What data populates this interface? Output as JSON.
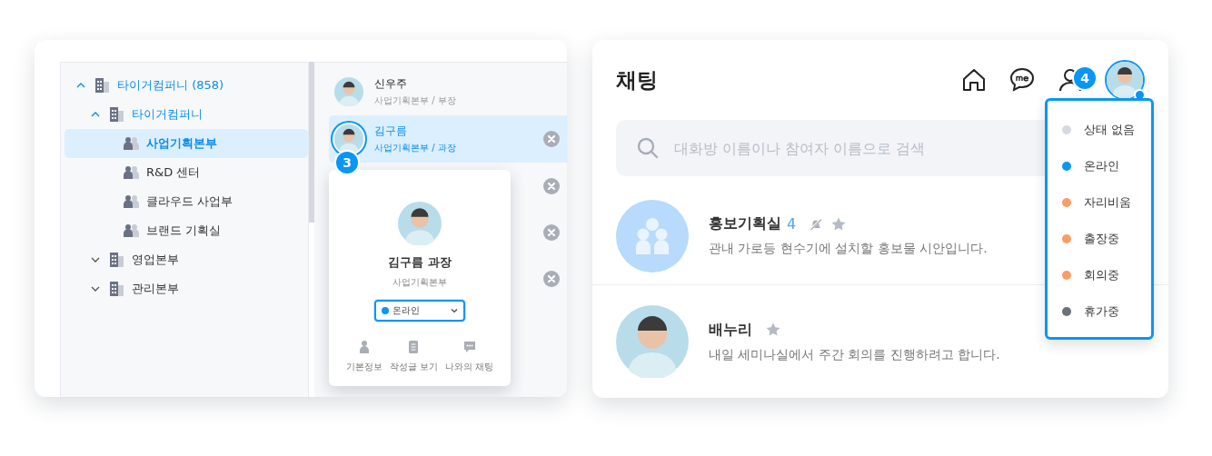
{
  "org_panel": {
    "tree": [
      {
        "label": "타이거컴퍼니 (858)",
        "kind": "company",
        "expanded": true,
        "selected": false,
        "children": [
          {
            "label": "타이거컴퍼니",
            "kind": "company",
            "expanded": true,
            "selected": false,
            "children": [
              {
                "label": "사업기획본부",
                "kind": "department",
                "selected": true
              },
              {
                "label": "R&D 센터",
                "kind": "department",
                "selected": false
              },
              {
                "label": "클라우드 사업부",
                "kind": "department",
                "selected": false
              },
              {
                "label": "브랜드 기획실",
                "kind": "department",
                "selected": false
              }
            ]
          },
          {
            "label": "영업본부",
            "kind": "company",
            "expanded": false,
            "selected": false
          },
          {
            "label": "관리본부",
            "kind": "company",
            "expanded": false,
            "selected": false
          }
        ]
      }
    ],
    "members": [
      {
        "name": "신우주",
        "subtitle": "사업기획본부 / 부장",
        "selected": false,
        "removable": false
      },
      {
        "name": "김구름",
        "subtitle": "사업기획본부 / 과장",
        "selected": true,
        "removable": true,
        "callout": "3"
      }
    ],
    "covered_rows": [
      {
        "removable": true
      },
      {
        "removable": true
      },
      {
        "removable": true
      }
    ],
    "profile_popup": {
      "name": "김구름 과장",
      "department": "사업기획본부",
      "status": {
        "label": "온라인",
        "color": "#0a96f5"
      },
      "actions": [
        {
          "label": "기본정보",
          "kind": "person"
        },
        {
          "label": "작성글 보기",
          "kind": "document"
        },
        {
          "label": "나와의 채팅",
          "kind": "chat"
        }
      ]
    }
  },
  "chat_panel": {
    "title": "채팅",
    "callout": "4",
    "status_dot": {
      "color": "#0a96f5"
    },
    "search": {
      "placeholder": "대화방 이름이나 참여자 이름으로 검색"
    },
    "status_menu": [
      {
        "label": "상태 없음",
        "color": "#d6d9df"
      },
      {
        "label": "온라인",
        "color": "#0a96f5"
      },
      {
        "label": "자리비움",
        "color": "#fb9d64"
      },
      {
        "label": "출장중",
        "color": "#fb9d64"
      },
      {
        "label": "회의중",
        "color": "#fb9d64"
      },
      {
        "label": "휴가중",
        "color": "#6b7079"
      }
    ],
    "rooms": [
      {
        "name": "홍보기획실",
        "kind": "group",
        "count": "4",
        "muted": true,
        "starred": false,
        "message": "관내 가로등 현수기에 설치할 홍보물 시안입니다."
      },
      {
        "name": "배누리",
        "kind": "person",
        "muted": false,
        "starred": false,
        "message": "내일 세미나실에서 주간 회의를 진행하려고 합니다."
      }
    ]
  }
}
